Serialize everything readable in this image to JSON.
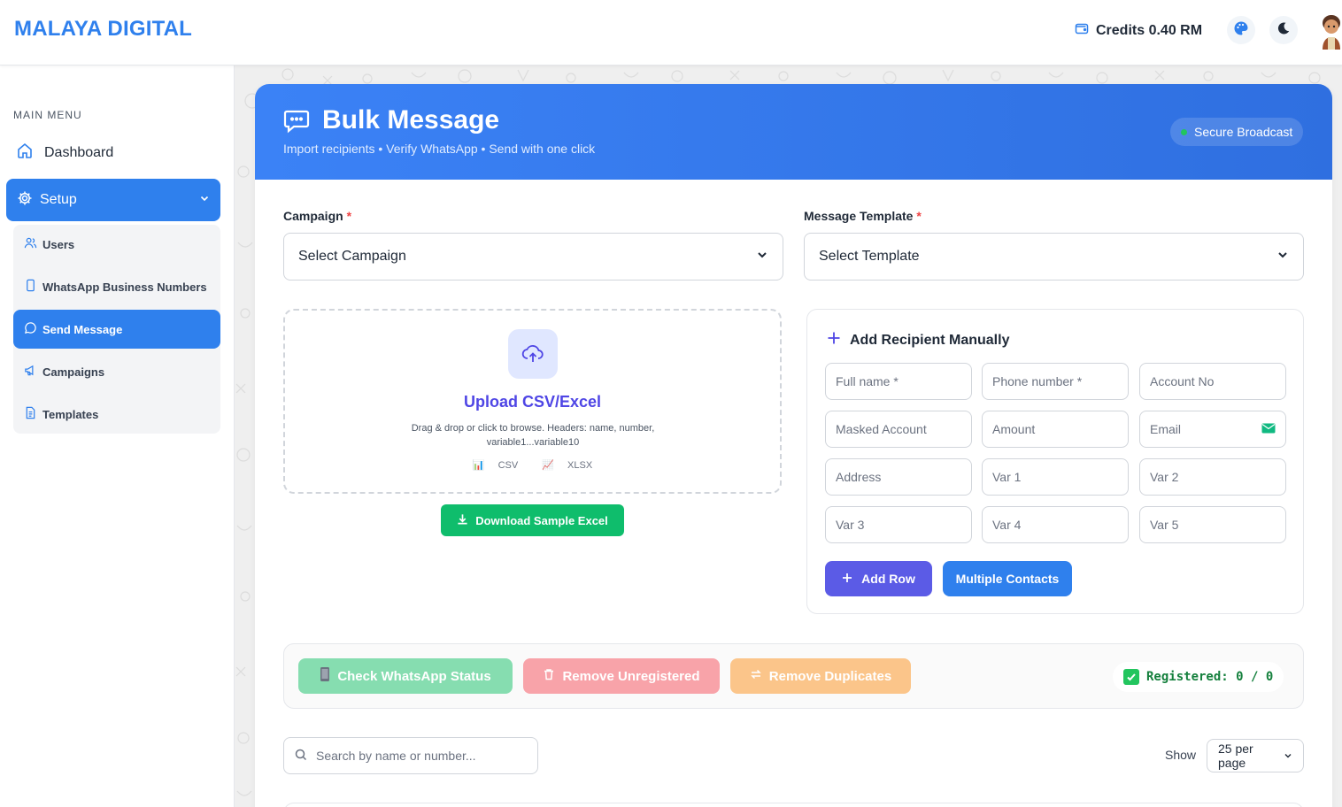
{
  "header": {
    "brand": "MALAYA DIGITAL",
    "credits": "Credits 0.40 RM"
  },
  "sidebar": {
    "section_title": "MAIN MENU",
    "dashboard": "Dashboard",
    "setup": "Setup",
    "items": [
      {
        "label": "Users"
      },
      {
        "label": "WhatsApp Business Numbers"
      },
      {
        "label": "Send Message"
      },
      {
        "label": "Campaigns"
      },
      {
        "label": "Templates"
      }
    ]
  },
  "page": {
    "title": "Bulk Message",
    "subtitle": "Import recipients • Verify WhatsApp • Send with one click",
    "badge": "Secure Broadcast",
    "campaign_label": "Campaign",
    "campaign_value": "Select Campaign",
    "template_label": "Message Template",
    "template_value": "Select Template",
    "required_mark": "*"
  },
  "upload": {
    "title": "Upload CSV/Excel",
    "hint": "Drag & drop or click to browse. Headers: name, number, variable1...variable10",
    "type_csv": "CSV",
    "type_xlsx": "XLSX",
    "download_label": "Download Sample Excel"
  },
  "manual": {
    "title": "Add Recipient Manually",
    "fields": [
      "Full name *",
      "Phone number *",
      "Account No",
      "Masked Account",
      "Amount",
      "Email",
      "Address",
      "Var 1",
      "Var 2",
      "Var 3",
      "Var 4",
      "Var 5"
    ],
    "add_row": "Add Row",
    "multiple": "Multiple Contacts"
  },
  "actions": {
    "check": "Check WhatsApp Status",
    "remove_unregistered": "Remove Unregistered",
    "remove_duplicates": "Remove Duplicates",
    "registered": "Registered: 0 / 0"
  },
  "list": {
    "search_placeholder": "Search by name or number...",
    "show_label": "Show",
    "per_page": "25 per page"
  },
  "colors": {
    "primary": "#2f80ed",
    "indigo": "#5b5be6",
    "green": "#0fbd6c"
  }
}
